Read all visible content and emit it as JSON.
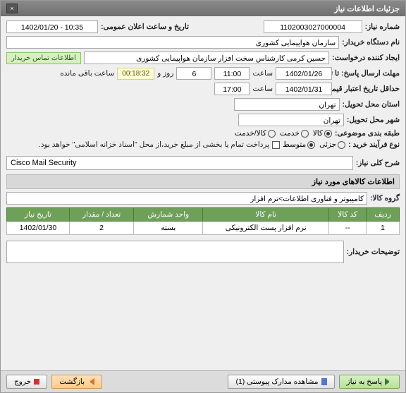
{
  "window": {
    "title": "جزئیات اطلاعات نیاز",
    "close": "×"
  },
  "fields": {
    "need_no_lbl": "شماره نیاز:",
    "need_no": "1102003027000004",
    "announce_lbl": "تاریخ و ساعت اعلان عمومی:",
    "announce": "1402/01/20 - 10:35",
    "buyer_org_lbl": "نام دستگاه خریدار:",
    "buyer_org": "سازمان هواپیمایی کشوری",
    "requester_lbl": "ایجاد کننده درخواست:",
    "requester": "حسین کرمی کارشناس سخت افزار سازمان هواپیمایی کشوری",
    "contact_badge": "اطلاعات تماس خریدار",
    "deadline_lbl": "مهلت ارسال پاسخ: تا تاریخ:",
    "deadline_date": "1402/01/26",
    "time_lbl": "ساعت",
    "deadline_time": "11:00",
    "days_lbl": "روز و",
    "days": "6",
    "remaining": "00:18:32",
    "remaining_lbl": "ساعت باقی مانده",
    "validity_lbl": "حداقل تاریخ اعتبار قیمت: تا تاریخ:",
    "validity_date": "1402/01/31",
    "validity_time": "17:00",
    "province_lbl": "استان محل تحویل:",
    "province": "تهران",
    "city_lbl": "شهر محل تحویل:",
    "city": "تهران",
    "category_lbl": "طبقه بندی موضوعی:",
    "cat_goods": "کالا",
    "cat_service": "خدمت",
    "cat_goodservice": "کالا/خدمت",
    "process_lbl": "نوع فرآیند خرید :",
    "proc_partial": "جزئی",
    "proc_medium": "متوسط",
    "payment_note": "پرداخت تمام یا بخشی از مبلغ خرید،از محل \"اسناد خزانه اسلامی\" خواهد بود.",
    "desc_lbl": "شرح کلی نیاز:",
    "desc": "Cisco Mail Security",
    "items_hdr": "اطلاعات کالاهای مورد نیاز",
    "group_lbl": "گروه کالا:",
    "group": "کامپیوتر و فناوری اطلاعات>نرم افزار",
    "notes_lbl": "توضیحات خریدار:"
  },
  "table": {
    "headers": {
      "row": "ردیف",
      "code": "کد کالا",
      "name": "نام کالا",
      "unit": "واحد شمارش",
      "qty": "تعداد / مقدار",
      "date": "تاریخ نیاز"
    },
    "rows": [
      {
        "row": "1",
        "code": "--",
        "name": "نرم افزار پست الکترونیکی",
        "unit": "بسته",
        "qty": "2",
        "date": "1402/01/30"
      }
    ]
  },
  "buttons": {
    "reply": "پاسخ به نیاز",
    "attachments": "مشاهده مدارک پیوستی (1)",
    "back": "بازگشت",
    "exit": "خروج"
  }
}
